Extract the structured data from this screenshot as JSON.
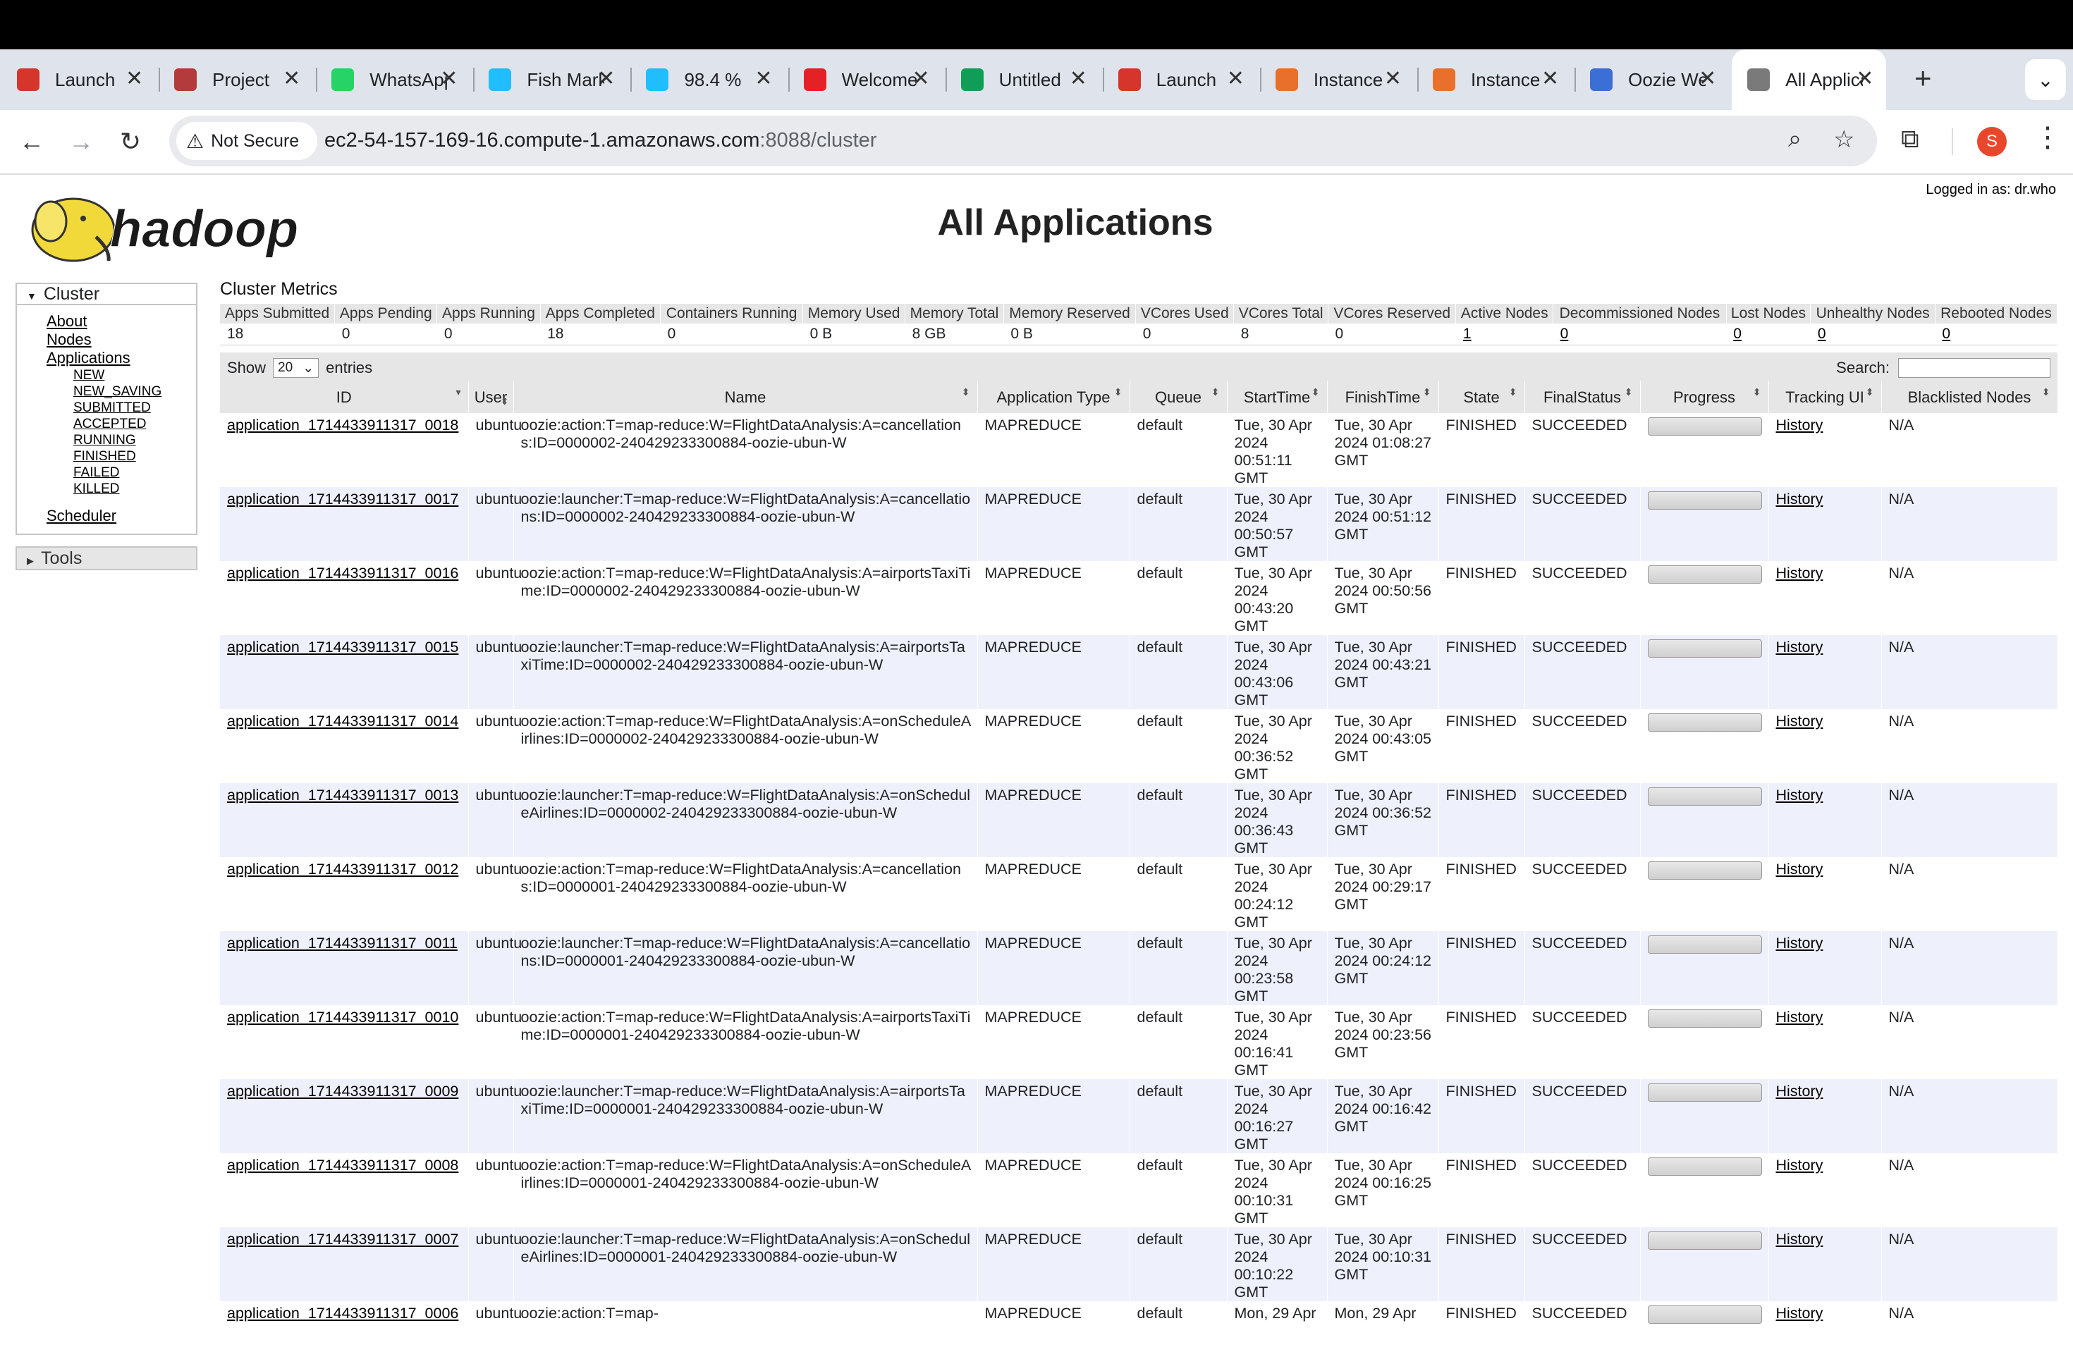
{
  "browser": {
    "tabs": [
      {
        "title": "Launch",
        "icon": "launch-icon",
        "color": "#d6352b"
      },
      {
        "title": "Project",
        "icon": "project-icon",
        "color": "#b33b3b"
      },
      {
        "title": "WhatsApp",
        "icon": "whatsapp-icon",
        "color": "#25d366"
      },
      {
        "title": "Fish Market",
        "icon": "kaggle-icon",
        "color": "#20beff"
      },
      {
        "title": "98.4 %",
        "icon": "kaggle-icon",
        "color": "#20beff"
      },
      {
        "title": "Welcome",
        "icon": "coursera-icon",
        "color": "#e52027"
      },
      {
        "title": "Untitled",
        "icon": "sheets-icon",
        "color": "#0f9d58"
      },
      {
        "title": "Launch",
        "icon": "launch-icon",
        "color": "#d6352b"
      },
      {
        "title": "Instance",
        "icon": "aws-icon",
        "color": "#e8702a"
      },
      {
        "title": "Instance",
        "icon": "aws-icon",
        "color": "#e8702a"
      },
      {
        "title": "Oozie Web",
        "icon": "oozie-icon",
        "color": "#3b6fd6"
      },
      {
        "title": "All Applications",
        "icon": "globe-icon",
        "color": "#7a7a7a",
        "active": true
      }
    ],
    "security_label": "Not Secure",
    "url_host": "ec2-54-157-169-16.compute-1.amazonaws.com",
    "url_rest": ":8088/cluster",
    "profile_initial": "S"
  },
  "page": {
    "logged_in": "Logged in as: dr.who",
    "title": "All Applications"
  },
  "sidebar": {
    "cluster_label": "Cluster",
    "links": [
      "About",
      "Nodes",
      "Applications"
    ],
    "states": [
      "NEW",
      "NEW_SAVING",
      "SUBMITTED",
      "ACCEPTED",
      "RUNNING",
      "FINISHED",
      "FAILED",
      "KILLED"
    ],
    "scheduler": "Scheduler",
    "tools_label": "Tools"
  },
  "metrics": {
    "title": "Cluster Metrics",
    "headers": [
      "Apps Submitted",
      "Apps Pending",
      "Apps Running",
      "Apps Completed",
      "Containers Running",
      "Memory Used",
      "Memory Total",
      "Memory Reserved",
      "VCores Used",
      "VCores Total",
      "VCores Reserved",
      "Active Nodes",
      "Decommissioned Nodes",
      "Lost Nodes",
      "Unhealthy Nodes",
      "Rebooted Nodes"
    ],
    "values": [
      "18",
      "0",
      "0",
      "18",
      "0",
      "0 B",
      "8 GB",
      "0 B",
      "0",
      "8",
      "0",
      "1",
      "0",
      "0",
      "0",
      "0"
    ]
  },
  "controls": {
    "show_label": "Show",
    "page_size": "20",
    "entries_label": "entries",
    "search_label": "Search:"
  },
  "table": {
    "headers": [
      "ID",
      "User",
      "Name",
      "Application Type",
      "Queue",
      "StartTime",
      "FinishTime",
      "State",
      "FinalStatus",
      "Progress",
      "Tracking UI",
      "Blacklisted Nodes"
    ],
    "rows": [
      {
        "id": "application_1714433911317_0018",
        "user": "ubuntu",
        "name": "oozie:action:T=map-reduce:W=FlightDataAnalysis:A=cancellations:ID=0000002-240429233300884-oozie-ubun-W",
        "type": "MAPREDUCE",
        "queue": "default",
        "start": "Tue, 30 Apr 2024 00:51:11 GMT",
        "finish": "Tue, 30 Apr 2024 01:08:27 GMT",
        "state": "FINISHED",
        "final": "SUCCEEDED",
        "progress": 100,
        "tracking": "History",
        "blacklisted": "N/A"
      },
      {
        "id": "application_1714433911317_0017",
        "user": "ubuntu",
        "name": "oozie:launcher:T=map-reduce:W=FlightDataAnalysis:A=cancellations:ID=0000002-240429233300884-oozie-ubun-W",
        "type": "MAPREDUCE",
        "queue": "default",
        "start": "Tue, 30 Apr 2024 00:50:57 GMT",
        "finish": "Tue, 30 Apr 2024 00:51:12 GMT",
        "state": "FINISHED",
        "final": "SUCCEEDED",
        "progress": 100,
        "tracking": "History",
        "blacklisted": "N/A"
      },
      {
        "id": "application_1714433911317_0016",
        "user": "ubuntu",
        "name": "oozie:action:T=map-reduce:W=FlightDataAnalysis:A=airportsTaxiTime:ID=0000002-240429233300884-oozie-ubun-W",
        "type": "MAPREDUCE",
        "queue": "default",
        "start": "Tue, 30 Apr 2024 00:43:20 GMT",
        "finish": "Tue, 30 Apr 2024 00:50:56 GMT",
        "state": "FINISHED",
        "final": "SUCCEEDED",
        "progress": 100,
        "tracking": "History",
        "blacklisted": "N/A"
      },
      {
        "id": "application_1714433911317_0015",
        "user": "ubuntu",
        "name": "oozie:launcher:T=map-reduce:W=FlightDataAnalysis:A=airportsTaxiTime:ID=0000002-240429233300884-oozie-ubun-W",
        "type": "MAPREDUCE",
        "queue": "default",
        "start": "Tue, 30 Apr 2024 00:43:06 GMT",
        "finish": "Tue, 30 Apr 2024 00:43:21 GMT",
        "state": "FINISHED",
        "final": "SUCCEEDED",
        "progress": 100,
        "tracking": "History",
        "blacklisted": "N/A"
      },
      {
        "id": "application_1714433911317_0014",
        "user": "ubuntu",
        "name": "oozie:action:T=map-reduce:W=FlightDataAnalysis:A=onScheduleAirlines:ID=0000002-240429233300884-oozie-ubun-W",
        "type": "MAPREDUCE",
        "queue": "default",
        "start": "Tue, 30 Apr 2024 00:36:52 GMT",
        "finish": "Tue, 30 Apr 2024 00:43:05 GMT",
        "state": "FINISHED",
        "final": "SUCCEEDED",
        "progress": 100,
        "tracking": "History",
        "blacklisted": "N/A"
      },
      {
        "id": "application_1714433911317_0013",
        "user": "ubuntu",
        "name": "oozie:launcher:T=map-reduce:W=FlightDataAnalysis:A=onScheduleAirlines:ID=0000002-240429233300884-oozie-ubun-W",
        "type": "MAPREDUCE",
        "queue": "default",
        "start": "Tue, 30 Apr 2024 00:36:43 GMT",
        "finish": "Tue, 30 Apr 2024 00:36:52 GMT",
        "state": "FINISHED",
        "final": "SUCCEEDED",
        "progress": 100,
        "tracking": "History",
        "blacklisted": "N/A"
      },
      {
        "id": "application_1714433911317_0012",
        "user": "ubuntu",
        "name": "oozie:action:T=map-reduce:W=FlightDataAnalysis:A=cancellations:ID=0000001-240429233300884-oozie-ubun-W",
        "type": "MAPREDUCE",
        "queue": "default",
        "start": "Tue, 30 Apr 2024 00:24:12 GMT",
        "finish": "Tue, 30 Apr 2024 00:29:17 GMT",
        "state": "FINISHED",
        "final": "SUCCEEDED",
        "progress": 100,
        "tracking": "History",
        "blacklisted": "N/A"
      },
      {
        "id": "application_1714433911317_0011",
        "user": "ubuntu",
        "name": "oozie:launcher:T=map-reduce:W=FlightDataAnalysis:A=cancellations:ID=0000001-240429233300884-oozie-ubun-W",
        "type": "MAPREDUCE",
        "queue": "default",
        "start": "Tue, 30 Apr 2024 00:23:58 GMT",
        "finish": "Tue, 30 Apr 2024 00:24:12 GMT",
        "state": "FINISHED",
        "final": "SUCCEEDED",
        "progress": 100,
        "tracking": "History",
        "blacklisted": "N/A"
      },
      {
        "id": "application_1714433911317_0010",
        "user": "ubuntu",
        "name": "oozie:action:T=map-reduce:W=FlightDataAnalysis:A=airportsTaxiTime:ID=0000001-240429233300884-oozie-ubun-W",
        "type": "MAPREDUCE",
        "queue": "default",
        "start": "Tue, 30 Apr 2024 00:16:41 GMT",
        "finish": "Tue, 30 Apr 2024 00:23:56 GMT",
        "state": "FINISHED",
        "final": "SUCCEEDED",
        "progress": 100,
        "tracking": "History",
        "blacklisted": "N/A"
      },
      {
        "id": "application_1714433911317_0009",
        "user": "ubuntu",
        "name": "oozie:launcher:T=map-reduce:W=FlightDataAnalysis:A=airportsTaxiTime:ID=0000001-240429233300884-oozie-ubun-W",
        "type": "MAPREDUCE",
        "queue": "default",
        "start": "Tue, 30 Apr 2024 00:16:27 GMT",
        "finish": "Tue, 30 Apr 2024 00:16:42 GMT",
        "state": "FINISHED",
        "final": "SUCCEEDED",
        "progress": 100,
        "tracking": "History",
        "blacklisted": "N/A"
      },
      {
        "id": "application_1714433911317_0008",
        "user": "ubuntu",
        "name": "oozie:action:T=map-reduce:W=FlightDataAnalysis:A=onScheduleAirlines:ID=0000001-240429233300884-oozie-ubun-W",
        "type": "MAPREDUCE",
        "queue": "default",
        "start": "Tue, 30 Apr 2024 00:10:31 GMT",
        "finish": "Tue, 30 Apr 2024 00:16:25 GMT",
        "state": "FINISHED",
        "final": "SUCCEEDED",
        "progress": 100,
        "tracking": "History",
        "blacklisted": "N/A"
      },
      {
        "id": "application_1714433911317_0007",
        "user": "ubuntu",
        "name": "oozie:launcher:T=map-reduce:W=FlightDataAnalysis:A=onScheduleAirlines:ID=0000001-240429233300884-oozie-ubun-W",
        "type": "MAPREDUCE",
        "queue": "default",
        "start": "Tue, 30 Apr 2024 00:10:22 GMT",
        "finish": "Tue, 30 Apr 2024 00:10:31 GMT",
        "state": "FINISHED",
        "final": "SUCCEEDED",
        "progress": 100,
        "tracking": "History",
        "blacklisted": "N/A"
      },
      {
        "id": "application_1714433911317_0006",
        "user": "ubuntu",
        "name": "oozie:action:T=map-",
        "type": "MAPREDUCE",
        "queue": "default",
        "start": "Mon, 29 Apr",
        "finish": "Mon, 29 Apr",
        "state": "FINISHED",
        "final": "SUCCEEDED",
        "progress": 100,
        "tracking": "History",
        "blacklisted": "N/A"
      }
    ]
  }
}
